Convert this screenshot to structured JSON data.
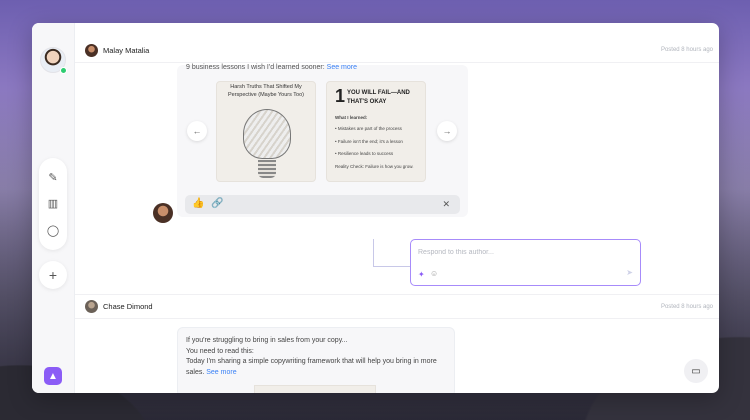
{
  "window": {
    "traffic_colors": [
      "#ff5f57",
      "#febc2e",
      "#28c840"
    ]
  },
  "sidebar": {
    "tools": [
      {
        "icon": "pencil-icon",
        "glyph": "✎"
      },
      {
        "icon": "stats-icon",
        "glyph": "▥"
      },
      {
        "icon": "chat-icon",
        "glyph": "◯"
      }
    ],
    "add_glyph": "+",
    "brand_glyph": "▲"
  },
  "posts": [
    {
      "author": "Malay Matalia",
      "posted": "Posted 8 hours ago",
      "intro": "9 business lessons I wish I'd learned sooner:",
      "see_more": "See more",
      "slides": [
        {
          "title": "Harsh Truths That Shifted My Perspective (Maybe Yours Too)"
        },
        {
          "number": "1",
          "heading_line1": "YOU WILL FAIL—AND",
          "heading_line2": "THAT'S OKAY",
          "what_learned": "What I learned:",
          "bullets": [
            "• Mistakes are part of the process",
            "• Failure isn't the end; it's a lesson",
            "• Resilience leads to success"
          ],
          "reality": "Reality Check: Failure is how you grow."
        }
      ],
      "prev_glyph": "←",
      "next_glyph": "→",
      "reactions": {
        "like": "👍",
        "link": "🔗",
        "close": "✕"
      },
      "respond_placeholder": "Respond to this author..."
    },
    {
      "author": "Chase Dimond",
      "posted": "Posted 8 hours ago",
      "lines": [
        "If you're struggling to bring in sales from your copy...",
        "You need to read this:",
        "Today I'm sharing a simple copywriting framework that will help you bring in more",
        "sales."
      ],
      "see_more": "See more"
    }
  ],
  "chat_glyph": "▭"
}
